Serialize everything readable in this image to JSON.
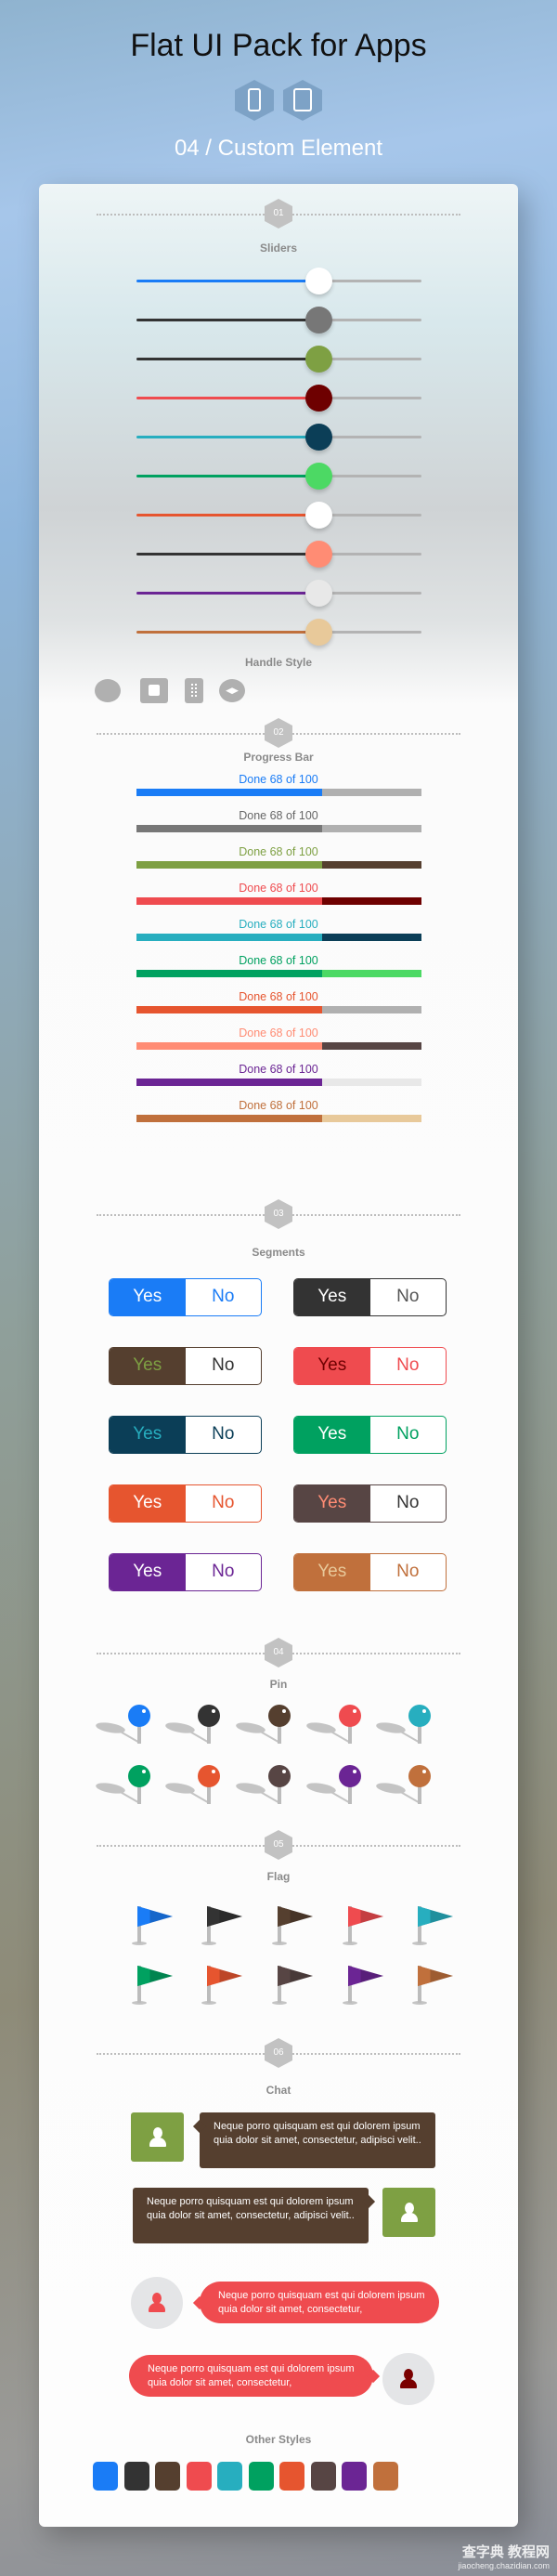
{
  "header": {
    "title": "Flat UI Pack for Apps",
    "devices": [
      "phone-icon",
      "tablet-icon"
    ],
    "subtitle": "04 / Custom Element"
  },
  "colors": {
    "blue": "#1a7cf6",
    "dark": "#333333",
    "brown": "#553f2f",
    "red": "#ef4b4f",
    "teal": "#27aebf",
    "green": "#00a160",
    "orange": "#e6552f",
    "darkbrown": "#574544",
    "purple": "#6b2594",
    "copper": "#c0703c"
  },
  "sections": [
    {
      "number": "01",
      "title": "Sliders"
    },
    {
      "number": "02",
      "title": "Progress Bar"
    },
    {
      "number": "03",
      "title": "Segments"
    },
    {
      "number": "04",
      "title": "Pin"
    },
    {
      "number": "05",
      "title": "Flag"
    },
    {
      "number": "06",
      "title": "Chat"
    }
  ],
  "sliders": {
    "value_percent": 64,
    "items": [
      {
        "fill": "#1a7cf6",
        "handle": "#ffffff"
      },
      {
        "fill": "#333333",
        "handle": "#777777"
      },
      {
        "fill": "#333333",
        "handle": "#7ea043"
      },
      {
        "fill": "#ef4b4f",
        "handle": "#6e0000"
      },
      {
        "fill": "#27aebf",
        "handle": "#0b3e57"
      },
      {
        "fill": "#00a160",
        "handle": "#4cd964"
      },
      {
        "fill": "#e6552f",
        "handle": "#ffffff"
      },
      {
        "fill": "#333333",
        "handle": "#ff8c74"
      },
      {
        "fill": "#6b2594",
        "handle": "#e8e8e8"
      },
      {
        "fill": "#c0703c",
        "handle": "#e8c99a"
      }
    ],
    "handle_style_title": "Handle Style",
    "handle_styles": [
      "circle",
      "square",
      "grip",
      "arrows"
    ]
  },
  "progress": {
    "done": 68,
    "total": 100,
    "items": [
      {
        "label": "Done 68 of 100",
        "text": "#1a7cf6",
        "fill": "#1a7cf6",
        "rest": "#b0b0b0"
      },
      {
        "label": "Done 68 of 100",
        "text": "#666666",
        "fill": "#777777",
        "rest": "#b0b0b0"
      },
      {
        "label": "Done 68 of 100",
        "text": "#7ea043",
        "fill": "#7ea043",
        "rest": "#553f2f"
      },
      {
        "label": "Done 68 of 100",
        "text": "#ef4b4f",
        "fill": "#ef4b4f",
        "rest": "#6e0000"
      },
      {
        "label": "Done 68 of 100",
        "text": "#27aebf",
        "fill": "#27aebf",
        "rest": "#0b3e57"
      },
      {
        "label": "Done 68 of 100",
        "text": "#00a160",
        "fill": "#00a160",
        "rest": "#4cd964"
      },
      {
        "label": "Done 68 of 100",
        "text": "#e6552f",
        "fill": "#e6552f",
        "rest": "#b0b0b0"
      },
      {
        "label": "Done 68 of 100",
        "text": "#ff8c74",
        "fill": "#ff8c74",
        "rest": "#574544"
      },
      {
        "label": "Done 68 of 100",
        "text": "#6b2594",
        "fill": "#6b2594",
        "rest": "#e8e8e8"
      },
      {
        "label": "Done 68 of 100",
        "text": "#c0703c",
        "fill": "#c0703c",
        "rest": "#e8c99a"
      }
    ]
  },
  "segments": [
    {
      "yes": "Yes",
      "no": "No",
      "bg": "#1a7cf6",
      "yes_color": "#ffffff",
      "no_color": "#1a7cf6"
    },
    {
      "yes": "Yes",
      "no": "No",
      "bg": "#333333",
      "yes_color": "#ffffff",
      "no_color": "#555555"
    },
    {
      "yes": "Yes",
      "no": "No",
      "bg": "#553f2f",
      "yes_color": "#7ea043",
      "no_color": "#333333"
    },
    {
      "yes": "Yes",
      "no": "No",
      "bg": "#ef4b4f",
      "yes_color": "#6e0000",
      "no_color": "#ef4b4f"
    },
    {
      "yes": "Yes",
      "no": "No",
      "bg": "#0b3e57",
      "yes_color": "#27aebf",
      "no_color": "#0b3e57"
    },
    {
      "yes": "Yes",
      "no": "No",
      "bg": "#00a160",
      "yes_color": "#ffffff",
      "no_color": "#00a160"
    },
    {
      "yes": "Yes",
      "no": "No",
      "bg": "#e6552f",
      "yes_color": "#ffffff",
      "no_color": "#e6552f"
    },
    {
      "yes": "Yes",
      "no": "No",
      "bg": "#574544",
      "yes_color": "#ff8c74",
      "no_color": "#333333"
    },
    {
      "yes": "Yes",
      "no": "No",
      "bg": "#6b2594",
      "yes_color": "#ffffff",
      "no_color": "#6b2594"
    },
    {
      "yes": "Yes",
      "no": "No",
      "bg": "#c0703c",
      "yes_color": "#e8c99a",
      "no_color": "#c0703c"
    }
  ],
  "pins": [
    "#1a7cf6",
    "#333333",
    "#553f2f",
    "#ef4b4f",
    "#27aebf",
    "#00a160",
    "#e6552f",
    "#574544",
    "#6b2594",
    "#c0703c"
  ],
  "flags": [
    "#1a7cf6",
    "#333333",
    "#553f2f",
    "#ef4b4f",
    "#27aebf",
    "#00a160",
    "#e6552f",
    "#574544",
    "#6b2594",
    "#c0703c"
  ],
  "chat": {
    "messages": [
      {
        "text": "Neque porro quisquam est qui dolorem ipsum quia dolor sit amet, consectetur, adipisci velit..",
        "side": "left",
        "style": "square",
        "bubble": "#553f2f",
        "avatar_bg": "#7ea043",
        "avatar_icon": "#ffffff"
      },
      {
        "text": "Neque porro quisquam est qui dolorem ipsum quia dolor sit amet, consectetur, adipisci velit..",
        "side": "right",
        "style": "square",
        "bubble": "#553f2f",
        "avatar_bg": "#7ea043",
        "avatar_icon": "#ffffff"
      },
      {
        "text": "Neque porro quisquam est qui dolorem ipsum quia dolor sit amet, consectetur,",
        "side": "left",
        "style": "round",
        "bubble": "#ef4b4f",
        "avatar_bg": "#e4e5e7",
        "avatar_icon": "#ef4b4f"
      },
      {
        "text": "Neque porro quisquam est qui dolorem ipsum quia dolor sit amet, consectetur,",
        "side": "right",
        "style": "round",
        "bubble": "#ef4b4f",
        "avatar_bg": "#e4e5e7",
        "avatar_icon": "#7a0000"
      }
    ],
    "other_styles_title": "Other Styles",
    "swatches": [
      "#1a7cf6",
      "#333333",
      "#553f2f",
      "#ef4b4f",
      "#27aebf",
      "#00a160",
      "#e6552f",
      "#574544",
      "#6b2594",
      "#c0703c"
    ]
  },
  "watermark": {
    "line1": "查字典 教程网",
    "line2": "jiaocheng.chazidian.com"
  }
}
